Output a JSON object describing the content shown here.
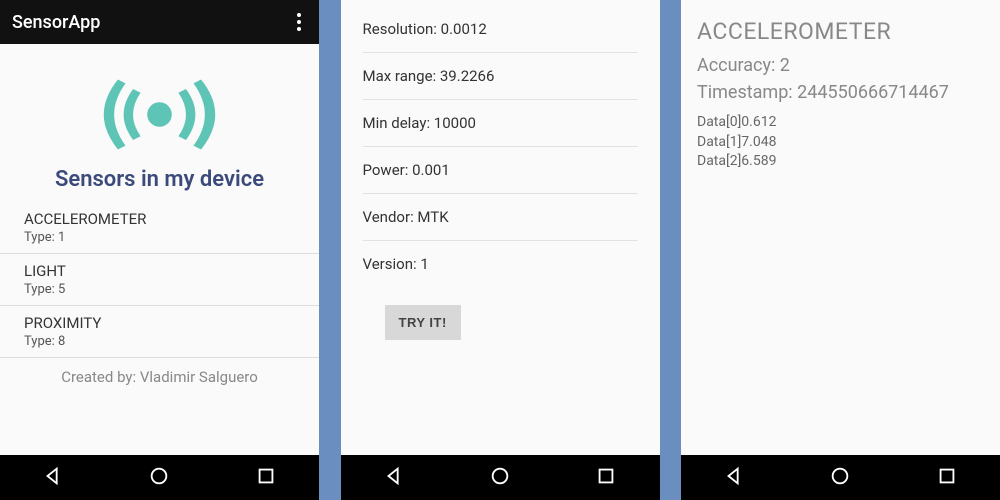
{
  "screen1": {
    "appbar_title": "SensorApp",
    "hero_title": "Sensors in my device",
    "sensors": [
      {
        "name": "ACCELEROMETER",
        "type_label": "Type: 1"
      },
      {
        "name": "LIGHT",
        "type_label": "Type: 5"
      },
      {
        "name": "PROXIMITY",
        "type_label": "Type: 8"
      }
    ],
    "credit": "Created by: Vladimir Salguero"
  },
  "screen2": {
    "rows": {
      "resolution": "Resolution: 0.0012",
      "max_range": "Max range: 39.2266",
      "min_delay": "Min delay: 10000",
      "power": "Power: 0.001",
      "vendor": "Vendor: MTK",
      "version": "Version: 1"
    },
    "try_button": "TRY IT!"
  },
  "screen3": {
    "sensor_name": "ACCELEROMETER",
    "accuracy": "Accuracy: 2",
    "timestamp": "Timestamp: 244550666714467",
    "data": [
      "Data[0]0.612",
      "Data[1]7.048",
      "Data[2]6.589"
    ]
  },
  "icons": {
    "accent": "#5ec5b6"
  }
}
